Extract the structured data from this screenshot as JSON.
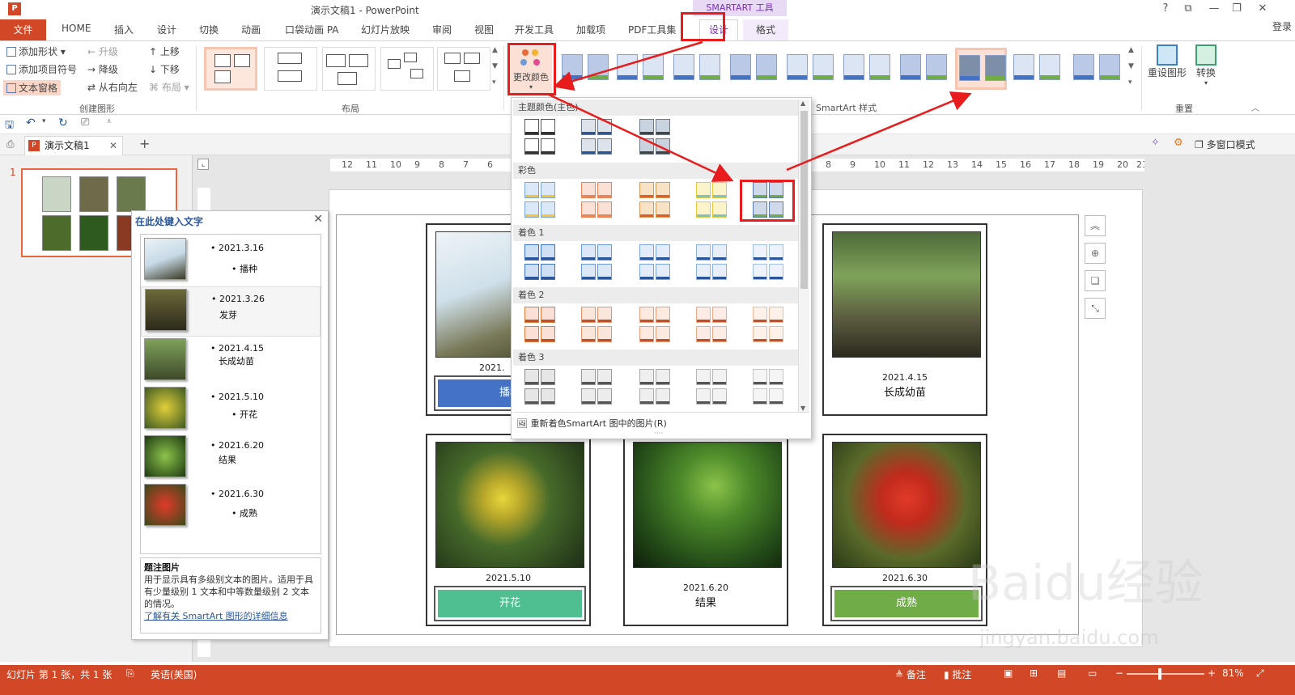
{
  "titlebar": {
    "title": "演示文稿1 - PowerPoint",
    "context_tools": "SMARTART 工具",
    "help": "?",
    "restore": "⧉",
    "minimize": "—",
    "maximize": "❐",
    "close": "✕",
    "login": "登录"
  },
  "tabs": [
    "文件",
    "HOME",
    "插入",
    "设计",
    "切换",
    "动画",
    "口袋动画 PA",
    "幻灯片放映",
    "审阅",
    "视图",
    "开发工具",
    "加载项",
    "PDF工具集",
    "设计",
    "格式"
  ],
  "ribbon": {
    "create": {
      "add_shape": "添加形状",
      "add_bullet": "添加项目符号",
      "text_pane": "文本窗格",
      "promote": "升级",
      "demote": "降级",
      "rtl": "从右向左",
      "move_up": "上移",
      "move_down": "下移",
      "layout": "布局",
      "group_label": "创建图形"
    },
    "layout_group_label": "布局",
    "change_colors": "更改颜色",
    "styles_group_label": "SmartArt 样式",
    "reset_graphic": "重设图形",
    "convert": "转换",
    "reset_group_label": "重置"
  },
  "doc_tab": {
    "name": "演示文稿1",
    "multi_window": "多窗口模式"
  },
  "slide_panel": {
    "slide_number": "1"
  },
  "text_pane": {
    "title": "在此处键入文字",
    "items": [
      {
        "date": "2021.3.16",
        "label": "播种"
      },
      {
        "date": "2021.3.26",
        "label": "发芽"
      },
      {
        "date": "2021.4.15",
        "label": "长成幼苗"
      },
      {
        "date": "2021.5.10",
        "label": "开花"
      },
      {
        "date": "2021.6.20",
        "label": "结果"
      },
      {
        "date": "2021.6.30",
        "label": "成熟"
      }
    ],
    "desc_title": "题注图片",
    "desc_body": "用于显示具有多级别文本的图片。适用于具有少量级别 1 文本和中等数量级别 2 文本的情况。",
    "desc_link": "了解有关 SmartArt 图形的详细信息"
  },
  "ruler": {
    "labels": [
      "12",
      "11",
      "10",
      "9",
      "8",
      "7",
      "6",
      "8",
      "9",
      "10",
      "11",
      "12",
      "13",
      "14",
      "15",
      "16",
      "17",
      "18",
      "19",
      "20",
      "21"
    ]
  },
  "cards": [
    {
      "date": "2021.",
      "label": "播种"
    },
    {
      "date": "2021.4.15",
      "label": "长成幼苗"
    },
    {
      "date": "2021.5.10",
      "label": "开花"
    },
    {
      "date": "2021.6.20",
      "label": "结果"
    },
    {
      "date": "2021.6.30",
      "label": "成熟"
    }
  ],
  "colors_dropdown": {
    "theme": "主题颜色(主色)",
    "colorful": "彩色",
    "accent1": "着色 1",
    "accent2": "着色 2",
    "accent3": "着色 3",
    "recolor": "重新着色SmartArt 图中的图片(R)"
  },
  "statusbar": {
    "slide_info": "幻灯片 第 1 张，共 1 张",
    "language": "英语(美国)",
    "notes": "备注",
    "comments": "批注",
    "zoom": "81%"
  },
  "colors": {
    "accent": "#d24726",
    "context": "#7b2fbe",
    "blue": "#4472c4",
    "green": "#70ad47",
    "teal": "#4fbf91",
    "highlight_red": "#e81c1c"
  },
  "watermark": {
    "brand": "Baidu经验",
    "url": "jingyan.baidu.com"
  }
}
